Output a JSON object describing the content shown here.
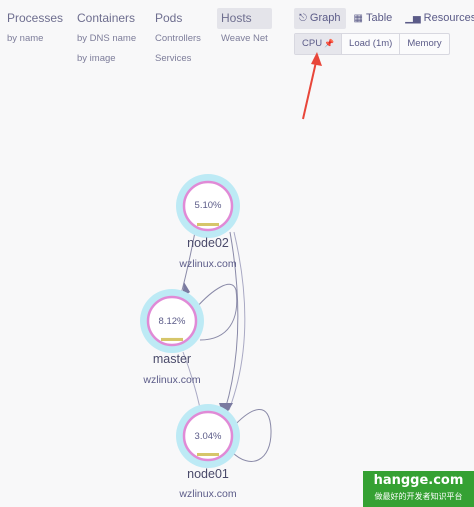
{
  "topologies": [
    {
      "label": "Processes",
      "subs": [
        "by name"
      ]
    },
    {
      "label": "Containers",
      "subs": [
        "by DNS name",
        "by image"
      ]
    },
    {
      "label": "Pods",
      "subs": [
        "Controllers",
        "Services"
      ]
    },
    {
      "label": "Hosts",
      "subs": [
        "Weave Net"
      ],
      "active": true
    }
  ],
  "view_modes": [
    {
      "label": "Graph",
      "icon": "graph-icon",
      "active": true
    },
    {
      "label": "Table",
      "icon": "table-icon"
    },
    {
      "label": "Resources",
      "icon": "bar-chart-icon"
    }
  ],
  "metrics": [
    {
      "label": "CPU",
      "pinned": true,
      "active": true
    },
    {
      "label": "Load (1m)"
    },
    {
      "label": "Memory"
    }
  ],
  "nodes": [
    {
      "id": "node02",
      "name": "node02",
      "subtitle": "wzlinux.com",
      "metric_label": "5.10%",
      "cpu_percent": 5.1
    },
    {
      "id": "master",
      "name": "master",
      "subtitle": "wzlinux.com",
      "metric_label": "8.12%",
      "cpu_percent": 8.12
    },
    {
      "id": "node01",
      "name": "node01",
      "subtitle": "wzlinux.com",
      "metric_label": "3.04%",
      "cpu_percent": 3.04
    }
  ],
  "watermark": {
    "title": "hangge.com",
    "subtitle": "做最好的开发者知识平台"
  },
  "colors": {
    "node_halo": "#bdeaf5",
    "node_ring": "#e08ad6",
    "metric_fill": "#d6c66a",
    "edge": "#8a8aa8",
    "arrow": "#e8463a"
  }
}
